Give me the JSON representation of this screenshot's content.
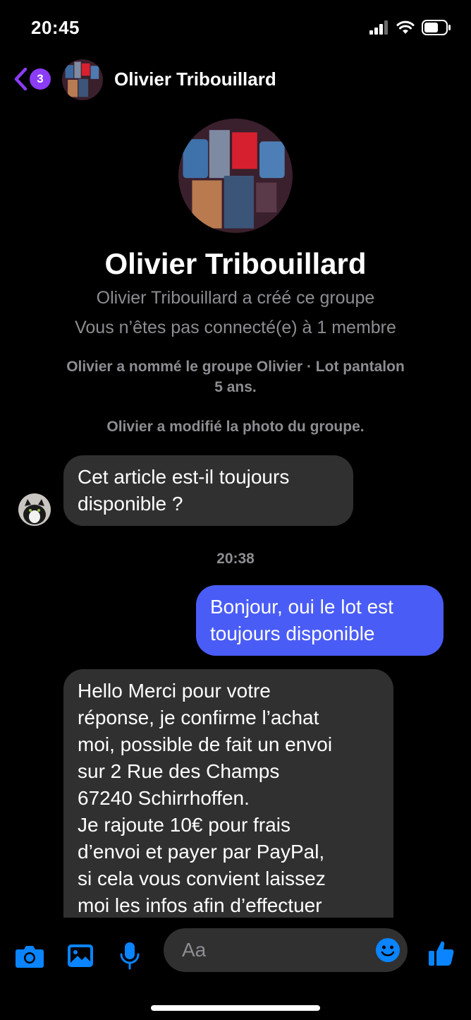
{
  "status": {
    "time": "20:45"
  },
  "header": {
    "badge_count": "3",
    "title": "Olivier Tribouillard"
  },
  "intro": {
    "name": "Olivier Tribouillard",
    "created_line": "Olivier Tribouillard a créé ce groupe",
    "connection_line": "Vous n’êtes pas connecté(e) à 1 membre",
    "rename_line1": "Olivier a nommé le groupe Olivier · Lot pantalon",
    "rename_line2": "5 ans.",
    "photo_line": "Olivier a modifié la photo du groupe."
  },
  "messages": [
    {
      "direction": "in",
      "line1": "Cet article est-il toujours",
      "line2": "disponible ?"
    },
    {
      "direction": "out",
      "line1": "Bonjour, oui le lot est",
      "line2": "toujours disponible"
    },
    {
      "direction": "in",
      "lines": [
        "Hello Merci pour votre",
        "réponse, je confirme l’achat",
        "moi, possible de fait un envoi",
        "sur 2 Rue des Champs",
        "67240 Schirrhoffen.",
        "Je rajoute 10€ pour frais",
        "d’envoi et payer par PayPal,",
        "si cela vous convient laissez",
        "moi les infos afin d’effectuer"
      ]
    }
  ],
  "timestamp": "20:38",
  "composer": {
    "placeholder": "Aa",
    "icons": [
      "camera-icon",
      "image-icon",
      "microphone-icon",
      "emoji-icon",
      "thumbs-up-icon"
    ]
  },
  "colors": {
    "accent": "#0a84ff",
    "badge": "#8b3cf6",
    "outgoing_bubble": "#4a5cf6",
    "incoming_bubble": "#303030",
    "muted_text": "#8d8d92"
  }
}
